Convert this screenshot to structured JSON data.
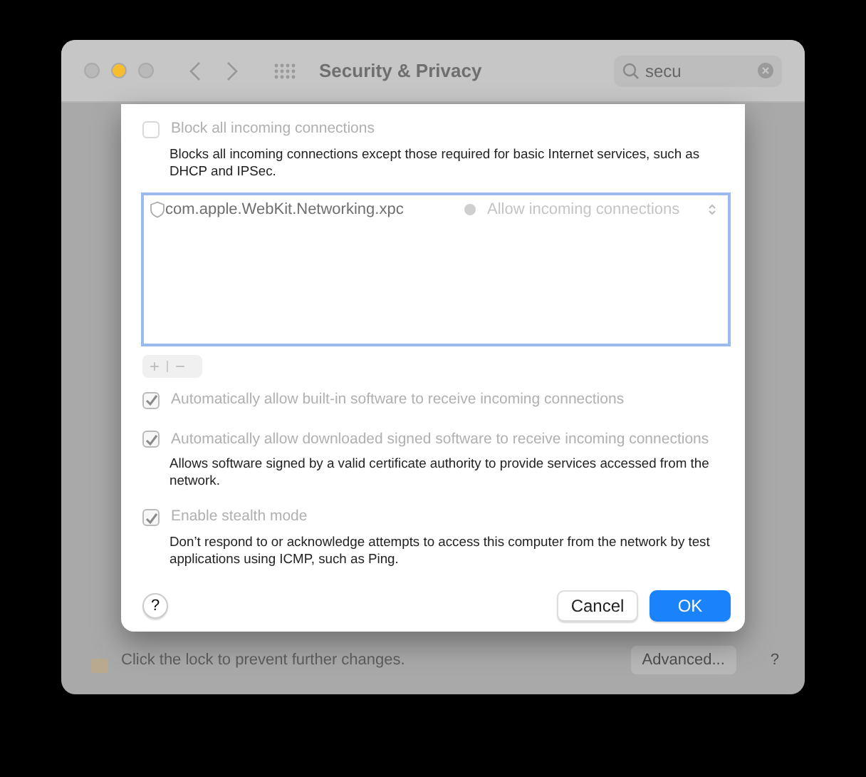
{
  "window": {
    "title": "Security & Privacy",
    "search": {
      "value": "secu"
    }
  },
  "footer": {
    "lock_text": "Click the lock to prevent further changes.",
    "advanced_button": "Advanced...",
    "help": "?"
  },
  "sheet": {
    "block_option": {
      "label": "Block all incoming connections",
      "checked": false,
      "disabled": true,
      "description": "Blocks all incoming connections except those required for basic Internet services, such as DHCP and IPSec."
    },
    "apps": [
      {
        "name": "com.apple.WebKit.Networking.xpc",
        "status": "Allow incoming connections",
        "color": "#cfcfcf"
      }
    ],
    "list_buttons": [
      "+",
      "−"
    ],
    "options": [
      {
        "label": "Automatically allow built-in software to receive incoming connections",
        "checked": true,
        "disabled": true
      },
      {
        "label": "Automatically allow downloaded signed software to receive incoming connections",
        "checked": true,
        "disabled": true,
        "description": "Allows software signed by a valid certificate authority to provide services accessed from the network."
      },
      {
        "label": "Enable stealth mode",
        "checked": true,
        "disabled": true,
        "description": "Don’t respond to or acknowledge attempts to access this computer from the network by test applications using ICMP, such as Ping."
      }
    ],
    "help": "?",
    "buttons": [
      {
        "label": "Cancel",
        "kind": "default"
      },
      {
        "label": "OK",
        "kind": "primary"
      }
    ]
  }
}
